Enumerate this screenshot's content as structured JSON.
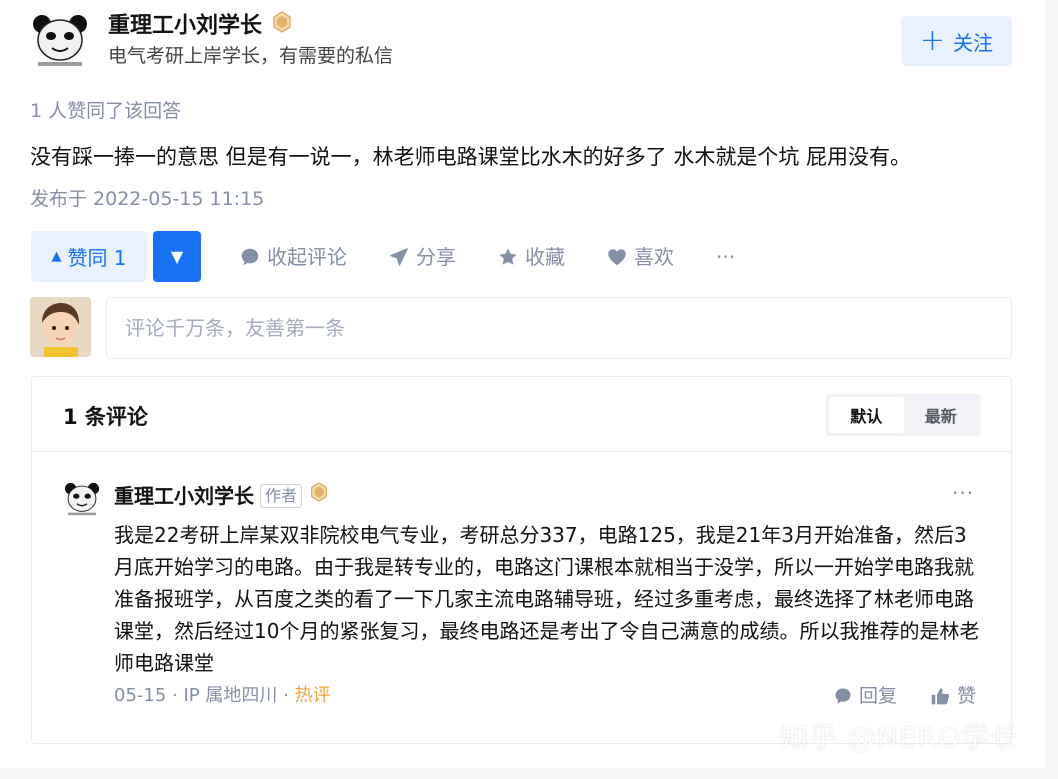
{
  "author": {
    "name": "重理工小刘学长",
    "bio": "电气考研上岸学长，有需要的私信",
    "avatar_icon": "panda-meme-avatar"
  },
  "follow": {
    "label": "关注",
    "icon": "plus-icon"
  },
  "answer": {
    "likers": "1 人赞同了该回答",
    "text": "没有踩一捧一的意思 但是有一说一，林老师电路课堂比水木的好多了 水木就是个坑 屁用没有。",
    "published": "发布于 2022-05-15 11:15"
  },
  "actions": {
    "vote_up": "赞同 1",
    "collapse_comments": "收起评论",
    "share": "分享",
    "favorite": "收藏",
    "like": "喜欢",
    "more": "···"
  },
  "comment_input": {
    "placeholder": "评论千万条，友善第一条"
  },
  "comments": {
    "count_label": "1 条评论",
    "sort": {
      "default": "默认",
      "latest": "最新"
    },
    "items": [
      {
        "author": "重理工小刘学长",
        "tag": "作者",
        "text": "我是22考研上岸某双非院校电气专业，考研总分337，电路125，我是21年3月开始准备，然后3月底开始学习的电路。由于我是转专业的，电路这门课根本就相当于没学，所以一开始学电路我就准备报班学，从百度之类的看了一下几家主流电路辅导班，经过多重考虑，最终选择了林老师电路课堂，然后经过10个月的紧张复习，最终电路还是考出了令自己满意的成绩。所以我推荐的是林老师电路课堂",
        "date": "05-15",
        "location": "IP 属地四川",
        "hot": "热评",
        "reply": "回复",
        "like": "赞",
        "more": "···"
      }
    ]
  },
  "watermark": "知乎 @NERO学长",
  "colors": {
    "brand_blue": "#1772f6",
    "light_blue": "#e8f1fc",
    "muted": "#8590a6",
    "hot": "#f1a53b"
  }
}
